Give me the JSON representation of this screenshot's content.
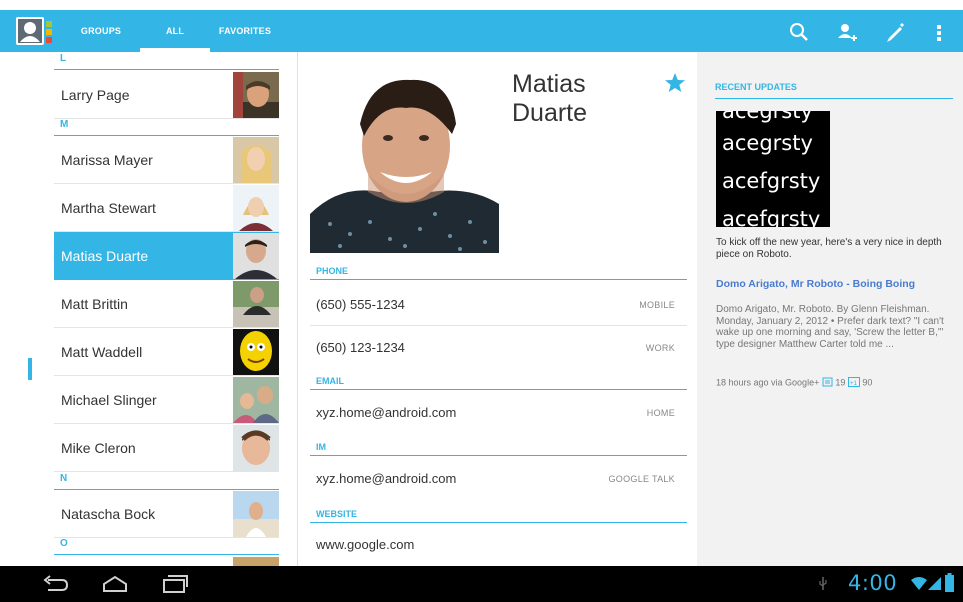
{
  "tabs": [
    {
      "label": "GROUPS"
    },
    {
      "label": "ALL",
      "selected": true
    },
    {
      "label": "FAVORITES"
    }
  ],
  "actions": [
    "search-icon",
    "add-contact-icon",
    "edit-icon",
    "overflow-menu-icon"
  ],
  "contacts": {
    "sections": {
      "l": "L",
      "m": "M",
      "n": "N",
      "o": "O"
    },
    "items": [
      {
        "name": "Larry Page"
      },
      {
        "name": "Marissa Mayer"
      },
      {
        "name": "Martha Stewart"
      },
      {
        "name": "Matias Duarte",
        "selected": true
      },
      {
        "name": "Matt Brittin"
      },
      {
        "name": "Matt Waddell"
      },
      {
        "name": "Michael Slinger"
      },
      {
        "name": "Mike Cleron"
      },
      {
        "name": "Natascha Bock"
      }
    ]
  },
  "detail": {
    "name": "Matias Duarte",
    "starred": true,
    "phone_header": "PHONE",
    "phones": [
      {
        "value": "(650) 555-1234",
        "type": "MOBILE"
      },
      {
        "value": "(650) 123-1234",
        "type": "WORK"
      }
    ],
    "email_header": "EMAIL",
    "email": {
      "value": "xyz.home@android.com",
      "type": "HOME"
    },
    "im_header": "IM",
    "im": {
      "value": "xyz.home@android.com",
      "type": "GOOGLE TALK"
    },
    "website_header": "WEBSITE",
    "website": {
      "value": "www.google.com"
    }
  },
  "updates": {
    "header": "RECENT UPDATES",
    "image_lines": [
      "acegrsty",
      "acegrsty",
      "acefgrsty",
      "acefgrsty"
    ],
    "caption": "To kick off the new year, here's a very nice in depth piece on Roboto.",
    "link": "Domo Arigato, Mr Roboto - Boing Boing",
    "body": "Domo Arigato, Mr. Roboto. By Glenn Fleishman. Monday, January 2, 2012 • Prefer dark text? \"I can't wake up one morning and say, 'Screw the letter B,'\" type designer Matthew Carter told me ...",
    "meta": "18 hours ago via Google+",
    "comments": "19",
    "plus_ones": "90"
  },
  "status": {
    "time": "4:00"
  },
  "colors": {
    "accent": "#33b5e5",
    "link": "#4a7bd0",
    "nav": "#000000"
  }
}
